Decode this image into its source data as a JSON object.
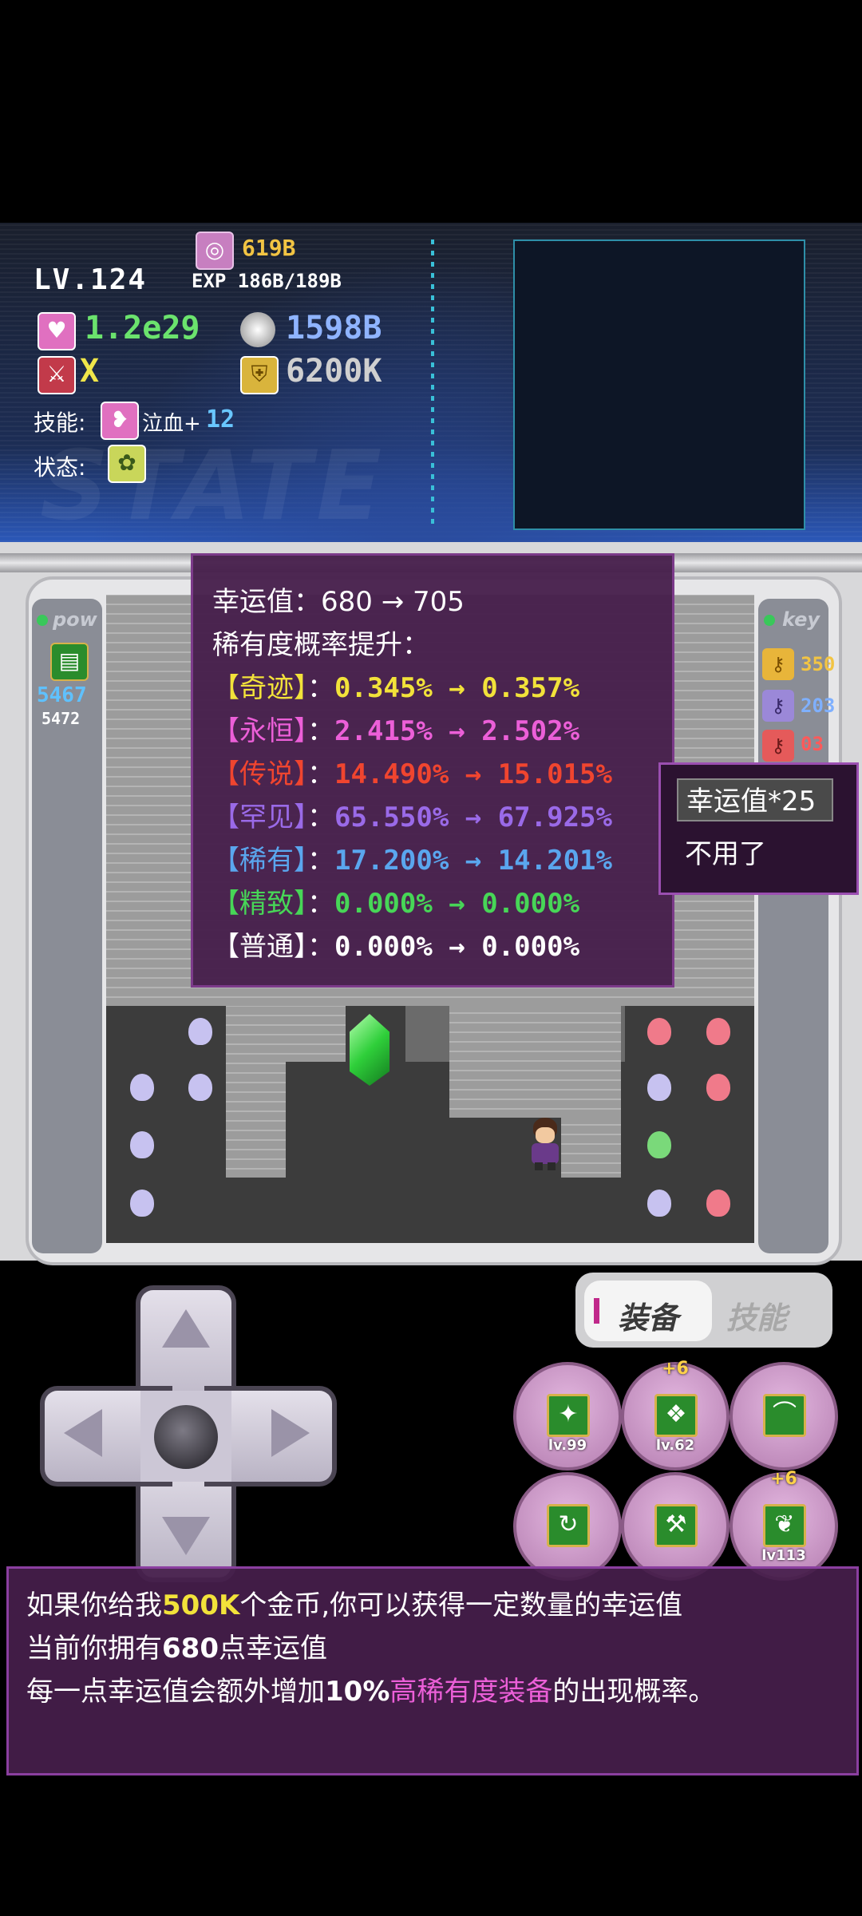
{
  "status": {
    "level": "LV.124",
    "gold": "619B",
    "exp": "EXP 186B/189B",
    "hp": "1.2e29",
    "attack": "1598B",
    "crit": "X",
    "defense": "6200K",
    "skill_label": "技能:",
    "skill_name": "泣血+",
    "skill_level": "12",
    "state_label": "状态:",
    "watermark": "STATE"
  },
  "side_left": {
    "label": "pow",
    "value": "5467",
    "max": "5472"
  },
  "side_right": {
    "label": "key",
    "keys": [
      {
        "color": "#e8b53a",
        "count": "350"
      },
      {
        "color": "#9b88d8",
        "count": "203"
      },
      {
        "color": "#e55a5a",
        "count": "03"
      }
    ]
  },
  "tooltip": {
    "luck_line": "幸运值：680 → 705",
    "title": "稀有度概率提升：",
    "rows": [
      {
        "name": "【奇迹】",
        "sep": "：",
        "value": "0.345% → 0.357%",
        "color": "#f2e23a"
      },
      {
        "name": "【永恒】",
        "sep": "：",
        "value": "2.415% → 2.502%",
        "color": "#ec5fd8"
      },
      {
        "name": "【传说】",
        "sep": "：",
        "value": "14.490% → 15.015%",
        "color": "#f0452f"
      },
      {
        "name": "【罕见】",
        "sep": "：",
        "value": "65.550% → 67.925%",
        "color": "#9a6ae8"
      },
      {
        "name": "【稀有】",
        "sep": "：",
        "value": "17.200% → 14.201%",
        "color": "#5aa6ee"
      },
      {
        "name": "【精致】",
        "sep": "：",
        "value": "0.000% → 0.000%",
        "color": "#47d657"
      },
      {
        "name": "【普通】",
        "sep": "：",
        "value": "0.000% → 0.000%",
        "color": "#ffffff"
      }
    ]
  },
  "choices": {
    "option1": "幸运值*25",
    "option2": "不用了"
  },
  "tabs": {
    "equip": "装备",
    "skill": "技能"
  },
  "skill_buttons": [
    {
      "icon": "boots-icon",
      "glyph": "✦",
      "level": "lv.99",
      "plus": ""
    },
    {
      "icon": "armor-icon",
      "glyph": "❖",
      "level": "lv.62",
      "plus": "+6"
    },
    {
      "icon": "scythe-icon",
      "glyph": "⌒",
      "level": "",
      "plus": ""
    },
    {
      "icon": "cycle-icon",
      "glyph": "↻",
      "level": "",
      "plus": ""
    },
    {
      "icon": "hammer-icon",
      "glyph": "⚒",
      "level": "",
      "plus": ""
    },
    {
      "icon": "leaf-icon",
      "glyph": "❦",
      "level": "lv113",
      "plus": "+6"
    }
  ],
  "dialog": {
    "line1_pre": "如果你给我",
    "line1_highlight": "500K",
    "line1_post": "个金币,你可以获得一定数量的幸运值",
    "line2_pre": "当前你拥有",
    "line2_highlight": "680",
    "line2_post": "点幸运值",
    "line3_pre": "每一点幸运值会额外增加",
    "line3_highlight": "10%",
    "line3_pink": "高稀有度装备",
    "line3_post": "的出现概率。"
  }
}
